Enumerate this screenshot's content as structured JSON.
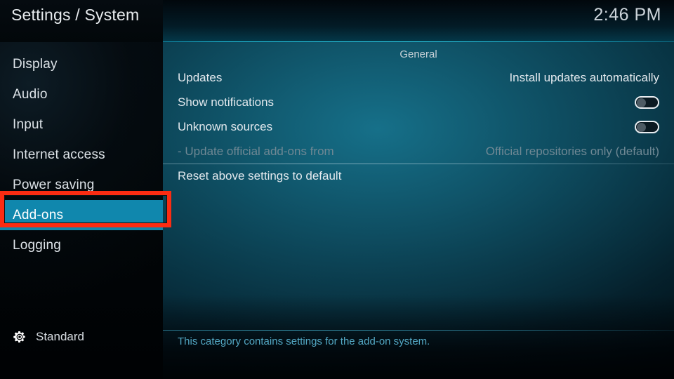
{
  "header": {
    "title": "Settings / System",
    "clock": "2:46 PM"
  },
  "sidebar": {
    "items": [
      {
        "label": "Display",
        "selected": false
      },
      {
        "label": "Audio",
        "selected": false
      },
      {
        "label": "Input",
        "selected": false
      },
      {
        "label": "Internet access",
        "selected": false
      },
      {
        "label": "Power saving",
        "selected": false
      },
      {
        "label": "Add-ons",
        "selected": true
      },
      {
        "label": "Logging",
        "selected": false
      }
    ],
    "level": {
      "icon": "gear-icon",
      "label": "Standard"
    }
  },
  "main": {
    "group_title": "General",
    "rows": [
      {
        "label": "Updates",
        "value": "Install updates automatically",
        "control": "text",
        "disabled": false,
        "separated": false
      },
      {
        "label": "Show notifications",
        "value": "",
        "control": "toggle",
        "toggle_on": false,
        "disabled": false,
        "separated": false
      },
      {
        "label": "Unknown sources",
        "value": "",
        "control": "toggle",
        "toggle_on": false,
        "disabled": false,
        "separated": false
      },
      {
        "label": "- Update official add-ons from",
        "value": "Official repositories only (default)",
        "control": "text",
        "disabled": true,
        "separated": false
      },
      {
        "label": "Reset above settings to default",
        "value": "",
        "control": "none",
        "disabled": false,
        "separated": true
      }
    ],
    "description": "This category contains settings for the add-on system."
  },
  "annotation": {
    "target": "Add-ons",
    "color": "#fc2c12"
  },
  "colors": {
    "accent_highlight": "#1087ad",
    "rule_cyan": "#2fd4ef",
    "description_text": "#53a8c4",
    "annotation_red": "#fc2c12",
    "disabled_text": "#6f8894"
  }
}
